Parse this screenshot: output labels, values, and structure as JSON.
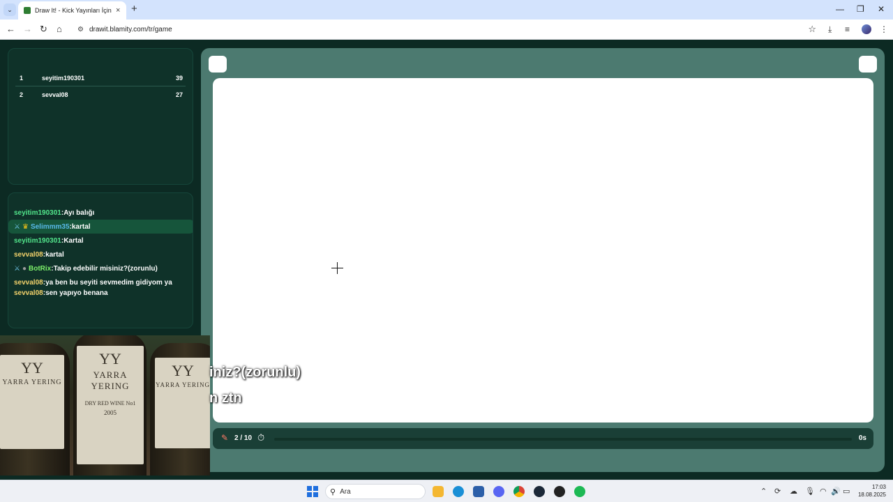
{
  "browser": {
    "tab_title": "Draw It! - Kick Yayınları İçin Çiz",
    "tab_close": "×",
    "new_tab": "+",
    "url": "drawit.blamity.com/tr/game",
    "window_controls": {
      "minimize": "—",
      "restore": "❐",
      "close": "✕"
    }
  },
  "scoreboard": [
    {
      "rank": "1",
      "name": "seyitim190301",
      "points": "39"
    },
    {
      "rank": "2",
      "name": "sevval08",
      "points": "27"
    }
  ],
  "chat": [
    {
      "user": "seyitim190301",
      "message": "Ayı balığı",
      "user_color": "u-green",
      "badges": [],
      "highlight": false
    },
    {
      "user": "Selimmm35",
      "message": "kartal",
      "user_color": "u-blue",
      "badges": [
        "sword",
        "crown"
      ],
      "highlight": true
    },
    {
      "user": "seyitim190301",
      "message": "Kartal",
      "user_color": "u-green",
      "badges": [],
      "highlight": false
    },
    {
      "user": "sevval08",
      "message": "kartal",
      "user_color": "u-yellow",
      "badges": [],
      "highlight": false
    },
    {
      "user": "BotRix",
      "message": "Takip edebilir misiniz?(zorunlu)",
      "user_color": "u-lime",
      "badges": [
        "sword",
        "bot"
      ],
      "highlight": false
    },
    {
      "user": "sevval08",
      "message": "ya ben bu seyiti sevmedim gidiyom ya",
      "user_color": "u-yellow",
      "badges": [],
      "highlight": false
    },
    {
      "user": "sevval08",
      "message": "sen yapıyo benana",
      "user_color": "u-yellow",
      "badges": [],
      "highlight": false
    }
  ],
  "game": {
    "round": "2 / 10",
    "time_left": "0s",
    "progress": 0,
    "accent_color": "#52e58b"
  },
  "webcam": {
    "brand": "YARRA YERING",
    "logo": "YY",
    "wine_name": "DRY RED WINE No1",
    "year": "2005"
  },
  "captions": [
    {
      "text": "iniz?(zorunlu)"
    },
    {
      "text": "n ztn"
    }
  ],
  "taskbar": {
    "search_placeholder": "Ara",
    "time": "17:03",
    "date": "18.08.2025"
  }
}
